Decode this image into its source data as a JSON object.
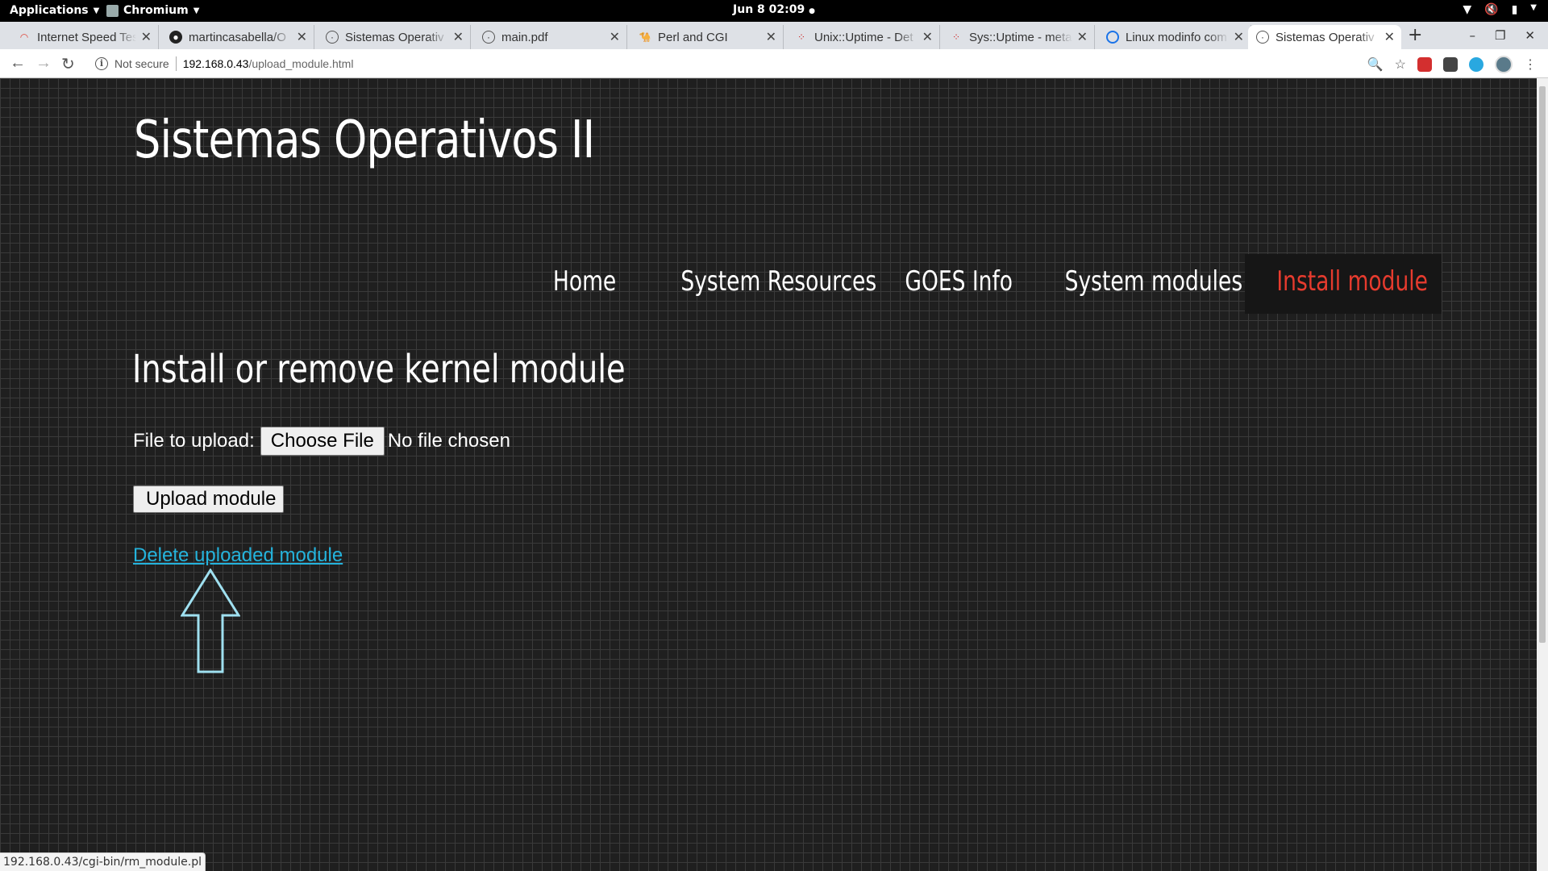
{
  "system_bar": {
    "applications": "Applications",
    "app_name": "Chromium",
    "clock": "Jun 8  02:09"
  },
  "tabs": [
    {
      "title": "Internet Speed Tes",
      "fav": "speed-icon",
      "color": "#e0453a"
    },
    {
      "title": "martincasabella/O",
      "fav": "github-icon",
      "color": "#222222"
    },
    {
      "title": "Sistemas Operativ",
      "fav": "globe-icon",
      "color": "#555555"
    },
    {
      "title": "main.pdf",
      "fav": "globe-icon",
      "color": "#555555"
    },
    {
      "title": "Perl and CGI",
      "fav": "camel-icon",
      "color": "#222222"
    },
    {
      "title": "Unix::Uptime - Det",
      "fav": "cpan-icon",
      "color": "#cc2222"
    },
    {
      "title": "Sys::Uptime - meta",
      "fav": "cpan-icon",
      "color": "#cc2222"
    },
    {
      "title": "Linux modinfo com",
      "fav": "g-icon",
      "color": "#1a73e8"
    },
    {
      "title": "Sistemas Operativ",
      "fav": "globe-icon",
      "color": "#555555"
    }
  ],
  "toolbar": {
    "not_secure": "Not secure",
    "host": "192.168.0.43",
    "path": "/upload_module.html"
  },
  "page": {
    "site_title": "Sistemas Operativos II",
    "nav": [
      {
        "label": "Home"
      },
      {
        "label": "System Resources"
      },
      {
        "label": "GOES Info"
      },
      {
        "label": "System modules"
      },
      {
        "label": "Install module",
        "active": true
      }
    ],
    "heading": "Install or remove kernel module",
    "file_label": "File to upload:",
    "choose_file": "Choose File",
    "no_file": "No file chosen",
    "upload_button": "Upload module",
    "delete_link": "Delete uploaded module",
    "accent_color": "#e63b2e",
    "link_color": "#24b3dc"
  },
  "status_url": "192.168.0.43/cgi-bin/rm_module.pl"
}
